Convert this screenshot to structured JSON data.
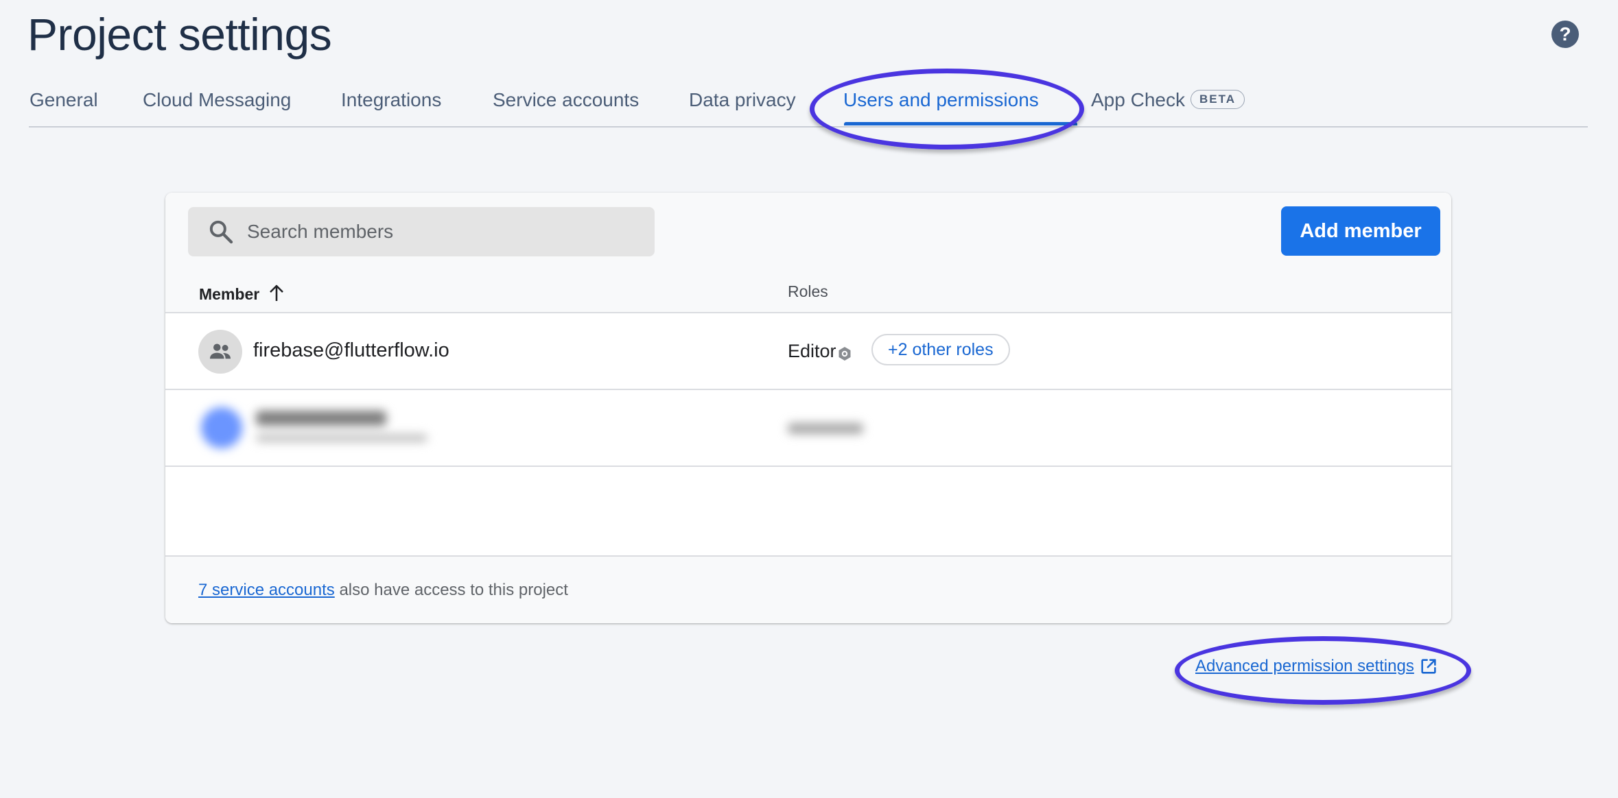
{
  "page": {
    "title": "Project settings",
    "help_icon": "help-circle-icon"
  },
  "tabs": [
    {
      "label": "General",
      "active": false
    },
    {
      "label": "Cloud Messaging",
      "active": false
    },
    {
      "label": "Integrations",
      "active": false
    },
    {
      "label": "Service accounts",
      "active": false
    },
    {
      "label": "Data privacy",
      "active": false
    },
    {
      "label": "Users and permissions",
      "active": true
    },
    {
      "label": "App Check",
      "active": false,
      "badge": "BETA"
    }
  ],
  "members_card": {
    "search": {
      "placeholder": "Search members",
      "value": ""
    },
    "add_button_label": "Add member",
    "columns": {
      "member": "Member",
      "roles": "Roles"
    },
    "sort_icon": "arrow-up-icon",
    "rows": [
      {
        "avatar_icon": "group-icon",
        "email": "firebase@flutterflow.io",
        "role": "Editor",
        "role_icon": "gear-icon",
        "other_roles_label": "+2 other roles"
      },
      {
        "redacted": true
      }
    ],
    "footer": {
      "link_text": "7 service accounts",
      "rest_text": "also have access to this project"
    }
  },
  "advanced_link": {
    "label": "Advanced permission settings",
    "icon": "open-in-new-icon"
  },
  "colors": {
    "accent": "#1a73e8",
    "annotation": "#4a35e0",
    "title": "#1f2f47"
  }
}
